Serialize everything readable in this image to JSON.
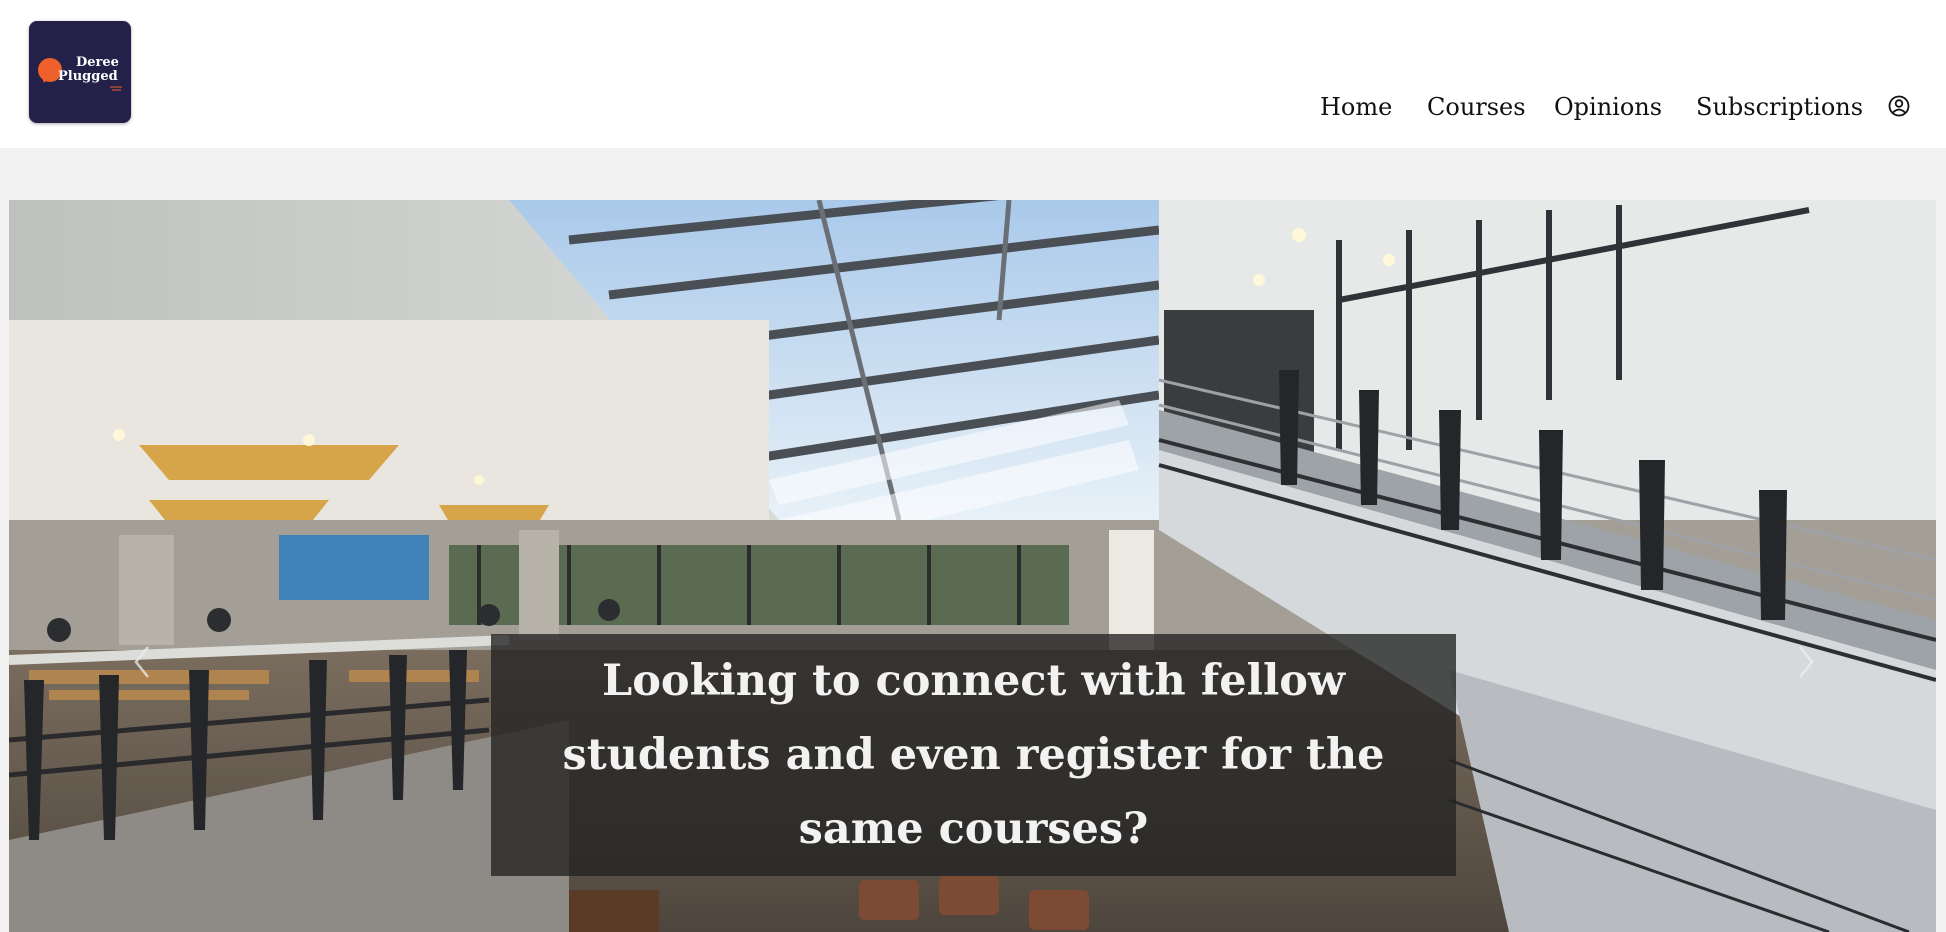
{
  "logo": {
    "line1": "Deree",
    "line2": "Plugged"
  },
  "nav": {
    "items": [
      {
        "label": "Home"
      },
      {
        "label": "Courses"
      },
      {
        "label": "Opinions"
      },
      {
        "label": "Subscriptions"
      }
    ],
    "account_icon": "user-circle-icon"
  },
  "hero": {
    "image": "library-atrium-with-skylight-and-staircase",
    "caption": "Looking to connect with fellow students and even register for the same courses?",
    "prev_icon": "chevron-left-icon",
    "next_icon": "chevron-right-icon"
  },
  "colors": {
    "logo_bg": "#23204a",
    "logo_accent": "#f0602a",
    "page_bg": "#f2f2f2",
    "header_bg": "#ffffff",
    "caption_bg": "#232323"
  }
}
